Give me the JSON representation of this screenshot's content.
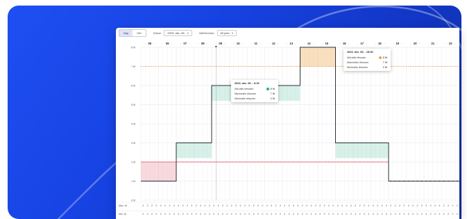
{
  "toolbar": {
    "view_a": "Nap",
    "view_b": "Hét",
    "date_label": "Dátum",
    "date_value": "2023. dec. 06.",
    "display_label": "Időfelbontás",
    "display_value": "60 perc"
  },
  "tooltip_left": {
    "title": "2023. dec. 06. - 9:15",
    "rows": [
      {
        "label": "Aktuális létszám",
        "value": "6 fő"
      },
      {
        "label": "Maximális létszám",
        "value": "7 fő"
      },
      {
        "label": "Minimális létszám",
        "value": "2 fő"
      }
    ]
  },
  "tooltip_right": {
    "title": "2023. dec. 06. - 15:30",
    "rows": [
      {
        "label": "Aktuális létszám",
        "value": "8 fő"
      },
      {
        "label": "Maximális létszám",
        "value": "7 fő"
      },
      {
        "label": "Minimális létszám",
        "value": "2 fő"
      }
    ]
  },
  "footer": {
    "row1_label": "Max. fő",
    "row2_label": "Min. fő"
  },
  "colors": {
    "actual_green": "#1fb384",
    "max_orange": "#f0a248",
    "min_red": "#e0506a",
    "hero_blue": "#1743e3"
  },
  "chart_data": {
    "type": "line",
    "x": [
      "05",
      "06",
      "07",
      "08",
      "09",
      "10",
      "11",
      "12",
      "13",
      "14",
      "15",
      "16",
      "17",
      "18",
      "19",
      "20",
      "21",
      "22"
    ],
    "y_ticks": [
      "0 fő",
      "1 fő",
      "2 fő",
      "3 fő",
      "4 fő",
      "5 fő",
      "6 fő",
      "7 fő",
      "8 fő"
    ],
    "ylim": [
      0,
      8
    ],
    "series": [
      {
        "values": [
          1,
          1,
          3,
          3,
          6,
          6,
          6,
          6,
          6,
          8,
          8,
          3,
          3,
          3,
          1,
          1,
          1,
          1
        ]
      },
      {
        "values": [
          7,
          7,
          7,
          7,
          7,
          7,
          7,
          7,
          7,
          7,
          7,
          7,
          7,
          7,
          7,
          7,
          7,
          7
        ]
      },
      {
        "values": [
          2,
          2,
          2,
          2,
          2,
          2,
          2,
          2,
          2,
          2,
          2,
          2,
          2,
          2,
          1,
          1,
          1,
          1
        ]
      }
    ],
    "footer_values": [
      "2",
      "2"
    ],
    "grid": true
  }
}
